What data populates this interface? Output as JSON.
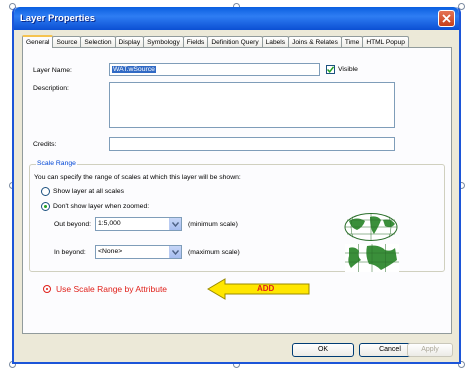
{
  "window": {
    "title": "Layer Properties"
  },
  "tabs": [
    "General",
    "Source",
    "Selection",
    "Display",
    "Symbology",
    "Fields",
    "Definition Query",
    "Labels",
    "Joins & Relates",
    "Time",
    "HTML Popup"
  ],
  "general": {
    "layer_name_label": "Layer Name:",
    "layer_name_value": "WAT.wSource",
    "visible_label": "Visible",
    "visible_checked": true,
    "description_label": "Description:",
    "description_value": "",
    "credits_label": "Credits:",
    "credits_value": ""
  },
  "scale_range": {
    "legend": "Scale Range",
    "intro": "You can specify the range of scales at which this layer will be shown:",
    "option_all": "Show layer at all scales",
    "option_zoomed": "Don't show layer when zoomed:",
    "selected_option": "zoomed",
    "out_beyond_label": "Out beyond:",
    "out_beyond_value": "1:5,000",
    "out_beyond_hint": "(minimum scale)",
    "in_beyond_label": "In beyond:",
    "in_beyond_value": "<None>",
    "in_beyond_hint": "(maximum scale)"
  },
  "annotation": {
    "text": "Use Scale Range by Attribute",
    "arrow_label": "ADD",
    "color": "#e0201a",
    "arrow_color": "#ffe600"
  },
  "footer": {
    "ok": "OK",
    "cancel": "Cancel",
    "apply": "Apply"
  }
}
